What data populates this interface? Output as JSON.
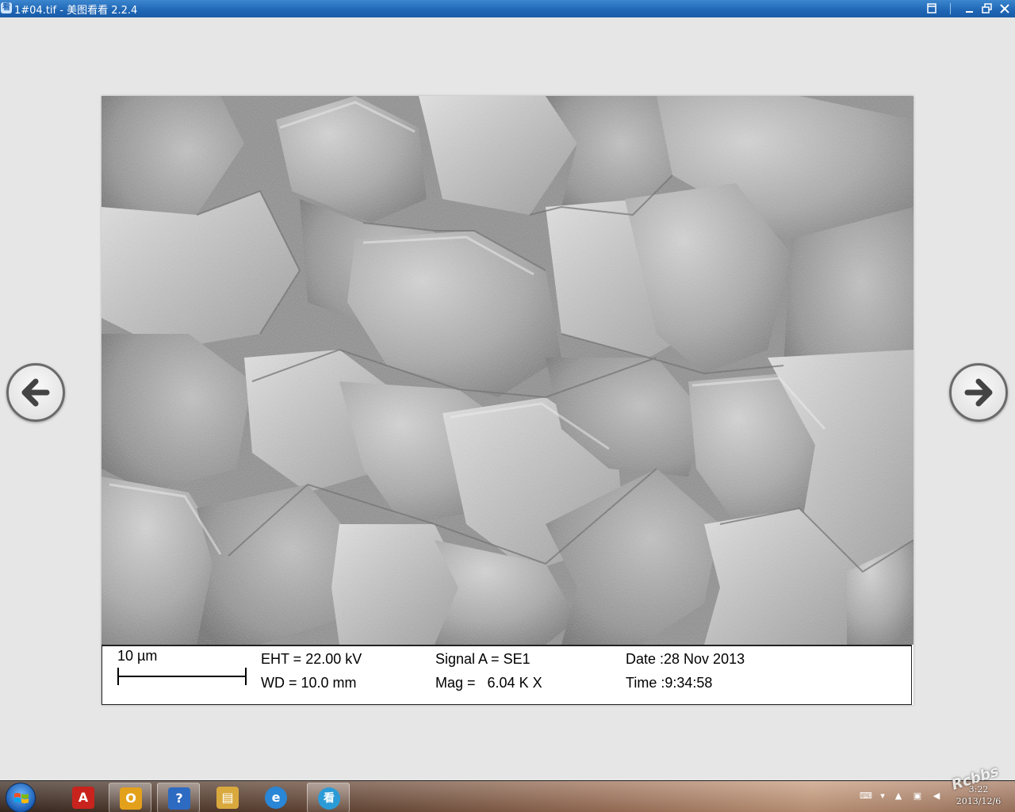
{
  "window": {
    "title": "1#04.tif - 美图看看 2.2.4",
    "app_icon_glyph": "看",
    "buttons": [
      "fullscreen-icon",
      "minimize-icon",
      "restore-icon",
      "close-icon"
    ]
  },
  "viewer": {
    "prev_icon": "arrow-left-icon",
    "next_icon": "arrow-right-icon"
  },
  "sem_databar": {
    "scale_label": "10 µm",
    "eht": "EHT = 22.00 kV",
    "wd": "WD = 10.0 mm",
    "signal": "Signal A = SE1",
    "mag": "Mag =   6.04 K X",
    "date": "Date :28 Nov 2013",
    "time": "Time :9:34:58"
  },
  "taskbar": {
    "start_icon": "windows-start-icon",
    "items": [
      {
        "name": "pdf-reader-icon",
        "glyph": "A",
        "color": "#c8231d"
      },
      {
        "name": "outlook-icon",
        "glyph": "O",
        "color": "#e3a11b"
      },
      {
        "name": "remote-assist-icon",
        "glyph": "?",
        "color": "#2d6ac1"
      },
      {
        "name": "file-explorer-icon",
        "glyph": "▤",
        "color": "#d9a93e"
      },
      {
        "name": "internet-explorer-icon",
        "glyph": "e",
        "color": "#2a86d6"
      },
      {
        "name": "image-viewer-icon",
        "glyph": "看",
        "color": "#2b9bd8"
      }
    ],
    "clock": {
      "time": "3:22",
      "date": "2013/12/6"
    },
    "watermark": "Rcbbs"
  }
}
